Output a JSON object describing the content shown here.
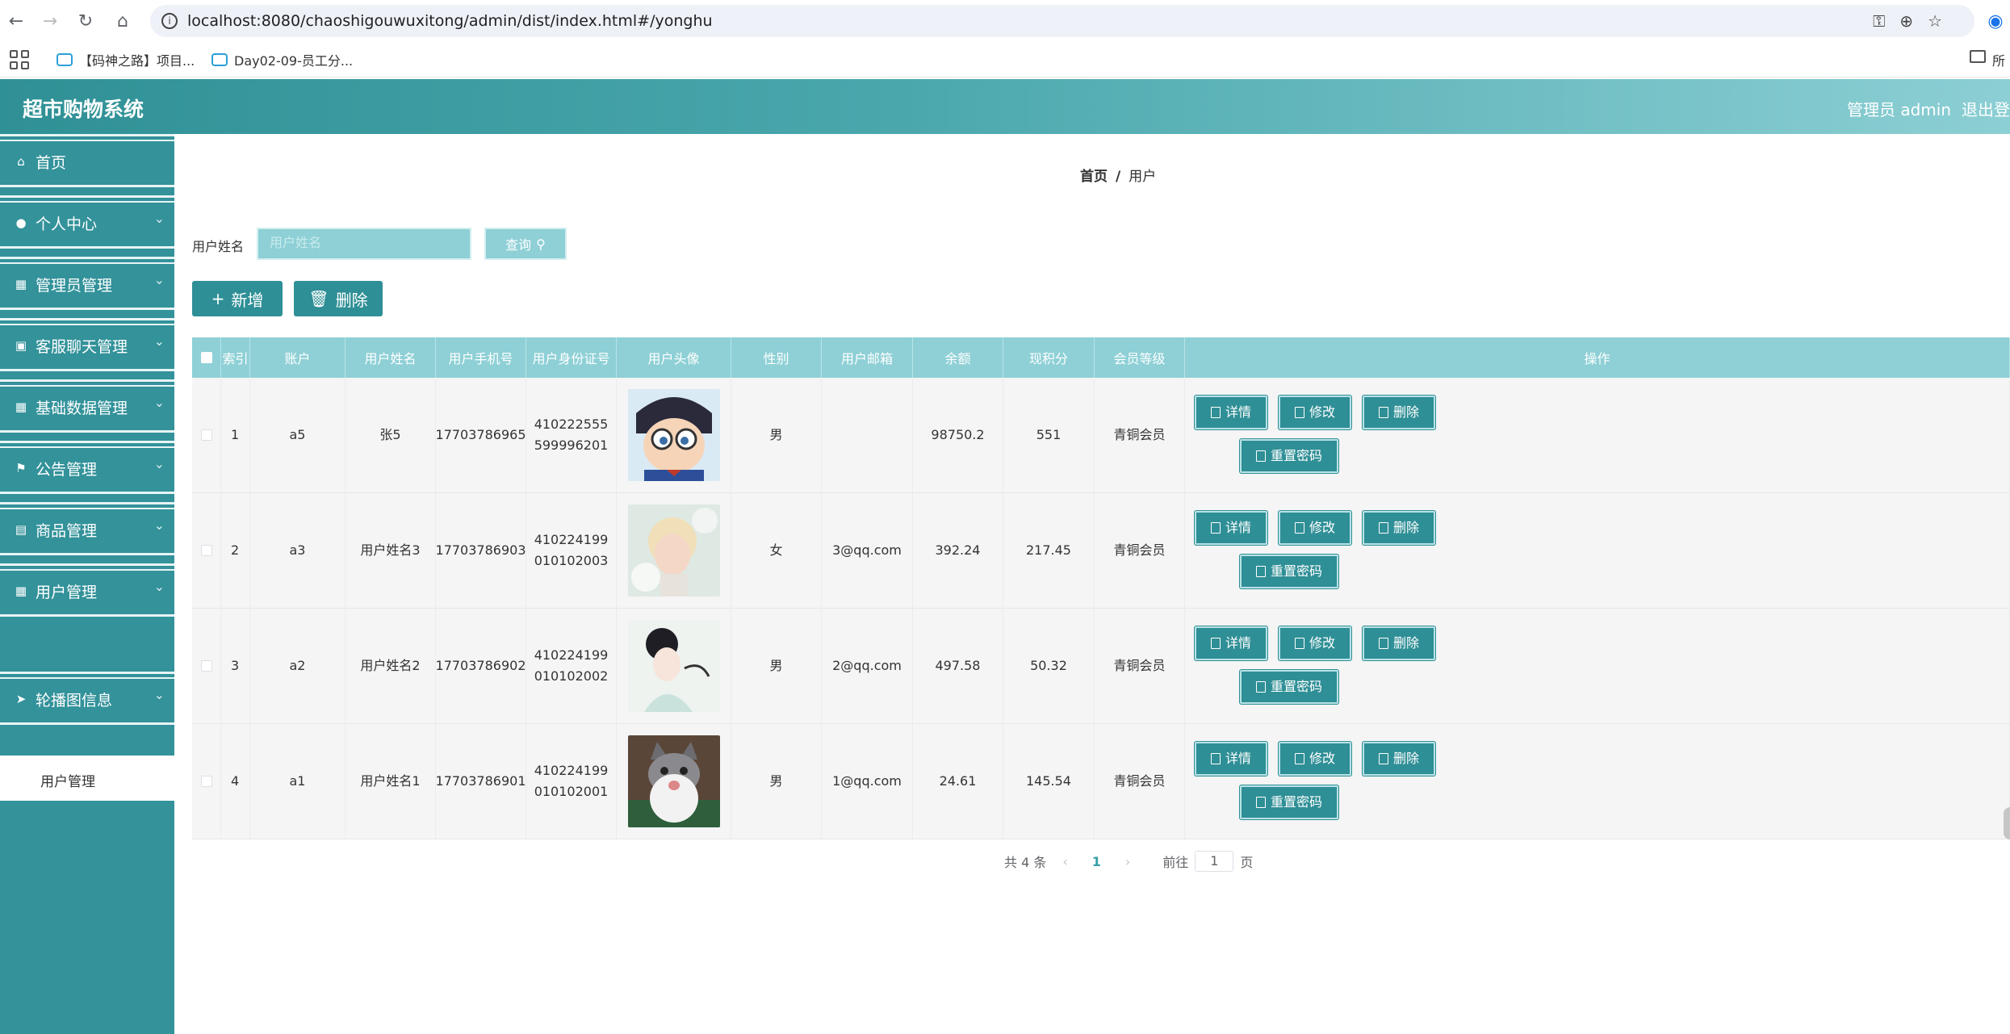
{
  "browser": {
    "url": "localhost:8080/chaoshigouwuxitong/admin/dist/index.html#/yonghu",
    "bookmarks": [
      "【码神之路】项目...",
      "Day02-09-员工分..."
    ],
    "bookmarks_folder": "所"
  },
  "app": {
    "title": "超市购物系统",
    "user_label": "管理员 admin",
    "logout_label": "退出登录"
  },
  "sidebar": {
    "items": [
      {
        "label": "首页",
        "icon": "home-icon",
        "arrow": false
      },
      {
        "label": "个人中心",
        "icon": "user-icon",
        "arrow": true
      },
      {
        "label": "管理员管理",
        "icon": "grid-icon",
        "arrow": true
      },
      {
        "label": "客服聊天管理",
        "icon": "chat-icon",
        "arrow": true
      },
      {
        "label": "基础数据管理",
        "icon": "grid-icon",
        "arrow": true
      },
      {
        "label": "公告管理",
        "icon": "flag-icon",
        "arrow": true
      },
      {
        "label": "商品管理",
        "icon": "shop-icon",
        "arrow": true
      },
      {
        "label": "用户管理",
        "icon": "grid-icon",
        "arrow": true
      },
      {
        "label": "轮播图信息",
        "icon": "send-icon",
        "arrow": true
      }
    ],
    "submenu_label": "用户管理"
  },
  "breadcrumb": {
    "home": "首页",
    "current": "用户"
  },
  "search": {
    "label": "用户姓名",
    "placeholder": "用户姓名",
    "button": "查询"
  },
  "actions": {
    "add": "新增",
    "delete": "删除"
  },
  "table": {
    "columns": [
      "索引",
      "账户",
      "用户姓名",
      "用户手机号",
      "用户身份证号",
      "用户头像",
      "性别",
      "用户邮箱",
      "余额",
      "现积分",
      "会员等级",
      "操作"
    ],
    "rows": [
      {
        "index": "1",
        "account": "a5",
        "name": "张5",
        "phone": "17703786965",
        "id_card": "410222555599996201",
        "avatar": "cartoon-boy-avatar",
        "gender": "男",
        "email": "",
        "balance": "98750.2",
        "points": "551",
        "level": "青铜会员"
      },
      {
        "index": "2",
        "account": "a3",
        "name": "用户姓名3",
        "phone": "17703786903",
        "id_card": "410224199010102003",
        "avatar": "blonde-person-avatar",
        "gender": "女",
        "email": "3@qq.com",
        "balance": "392.24",
        "points": "217.45",
        "level": "青铜会员"
      },
      {
        "index": "3",
        "account": "a2",
        "name": "用户姓名2",
        "phone": "17703786902",
        "id_card": "410224199010102002",
        "avatar": "woman-portrait-avatar",
        "gender": "男",
        "email": "2@qq.com",
        "balance": "497.58",
        "points": "50.32",
        "level": "青铜会员"
      },
      {
        "index": "4",
        "account": "a1",
        "name": "用户姓名1",
        "phone": "17703786901",
        "id_card": "410224199010102001",
        "avatar": "cat-avatar",
        "gender": "男",
        "email": "1@qq.com",
        "balance": "24.61",
        "points": "145.54",
        "level": "青铜会员"
      }
    ],
    "op_labels": {
      "detail": "详情",
      "edit": "修改",
      "delete": "删除",
      "reset": "重置密码"
    }
  },
  "pagination": {
    "total_text": "共 4 条",
    "current_page": "1",
    "goto_label": "前往",
    "goto_value": "1",
    "page_suffix": "页"
  },
  "colors": {
    "primary": "#2f8f96",
    "header_light": "#8ed0d6",
    "sidebar": "#33929a"
  }
}
